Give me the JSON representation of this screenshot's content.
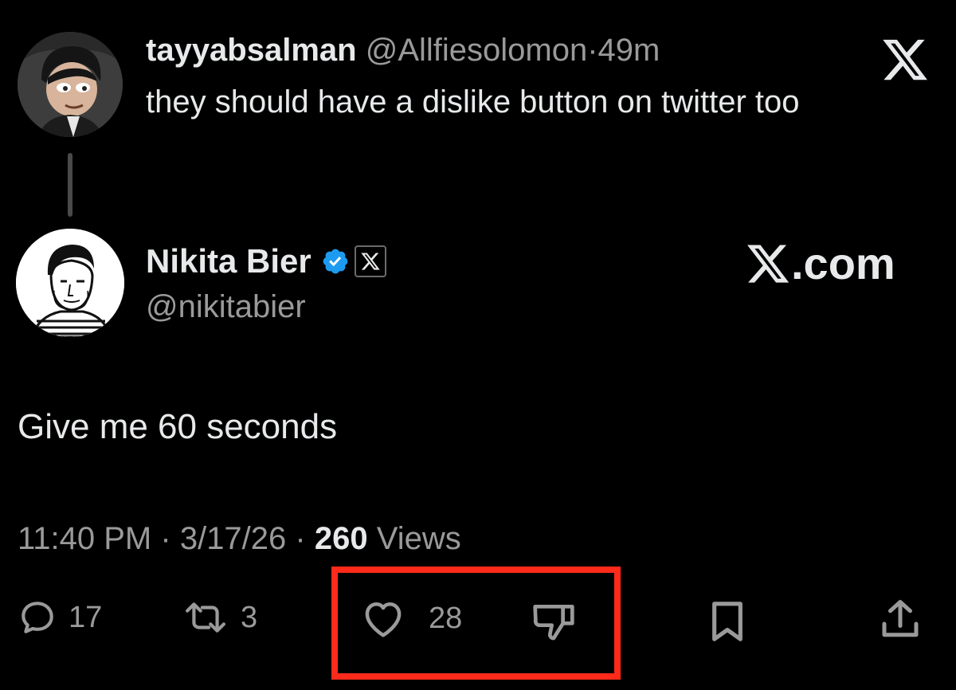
{
  "reply_tweet": {
    "display_name": "tayyabsalman",
    "handle": "@Allfiesolomon",
    "separator": "·",
    "time_ago": "49m",
    "text": "they should have a dislike button on twitter too",
    "avatar_icon": "cartoon-avatar",
    "platform_icon": "x-logo-icon"
  },
  "main_tweet": {
    "display_name": "Nikita Bier",
    "handle": "@nikitabier",
    "verified_icon": "verified-badge-icon",
    "verified_color": "#1d9bf0",
    "affiliation_icon": "x-affiliate-badge-icon",
    "watermark": ".com",
    "text": "Give me 60 seconds",
    "time": "11:40 PM",
    "date": "3/17/26",
    "separator": "·",
    "views_count": "260",
    "views_label": "Views"
  },
  "actions": {
    "reply_count": "17",
    "retweet_count": "3",
    "like_count": "28"
  },
  "highlight_color": "#ff2a1a"
}
